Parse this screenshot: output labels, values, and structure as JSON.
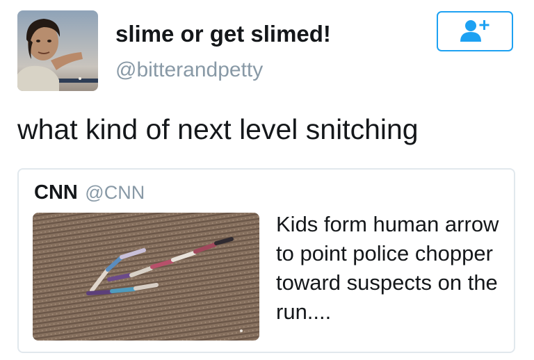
{
  "tweet": {
    "display_name": "slime or get slimed!",
    "handle": "@bitterandpetty",
    "text": "what kind of next level snitching",
    "follow_icon": "add-user-icon",
    "accent_color": "#1da1f2"
  },
  "quote": {
    "name": "CNN",
    "handle": "@CNN",
    "text": "Kids form human arrow to point police chopper toward suspects on the run...."
  }
}
